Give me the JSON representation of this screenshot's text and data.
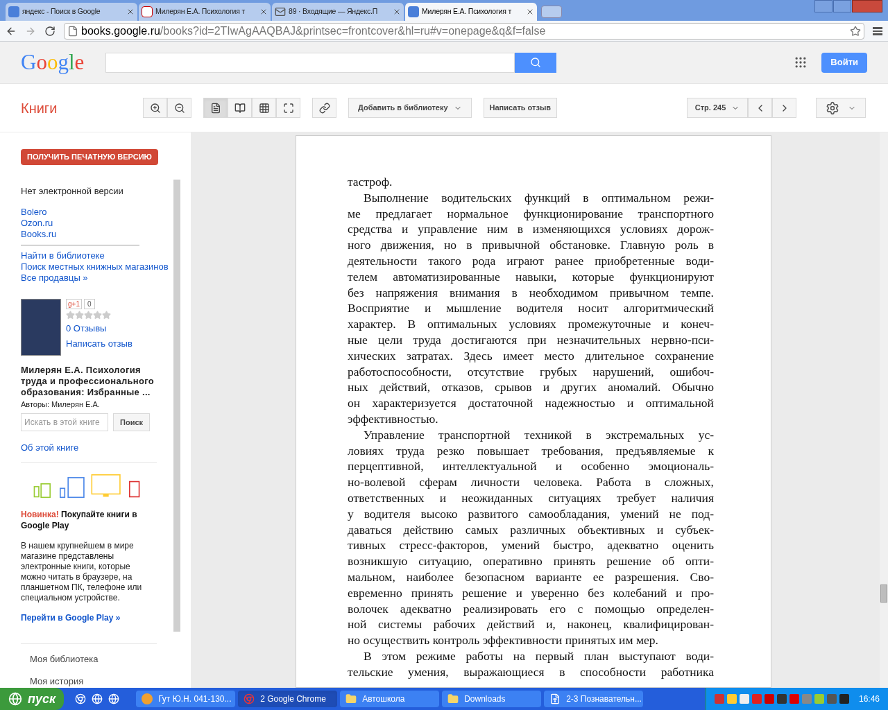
{
  "browser": {
    "tabs": [
      {
        "kind": "google",
        "title": "яндекс - Поиск в Google",
        "selected": false
      },
      {
        "kind": "yandex",
        "title": "Милерян Е.А. Психология т",
        "selected": false
      },
      {
        "kind": "mail",
        "title": "89 · Входящие — Яндекс.П",
        "selected": false
      },
      {
        "kind": "google",
        "title": "Милерян Е.А. Психология т",
        "selected": true
      }
    ],
    "url_host": "books.google.ru",
    "url_path": "/books?id=2TIwAgAAQBAJ&printsec=frontcover&hl=ru#v=onepage&q&f=false"
  },
  "header": {
    "logo": "Google",
    "signin": "Войти"
  },
  "toolbar": {
    "section": "Книги",
    "view_modes": [
      {
        "kind": "single",
        "selected": true
      },
      {
        "kind": "double",
        "selected": false
      },
      {
        "kind": "thumbnails",
        "selected": false
      },
      {
        "kind": "fullscreen",
        "selected": false
      }
    ],
    "add_library": "Добавить в библиотеку",
    "write_review": "Написать отзыв",
    "page": "Стр. 245"
  },
  "sidebar": {
    "print_button": "ПОЛУЧИТЬ ПЕЧАТНУЮ ВЕРСИЮ",
    "no_ebook": "Нет электронной версии",
    "stores": [
      "Bolero",
      "Ozon.ru",
      "Books.ru"
    ],
    "more_links": [
      "Найти в библиотеке",
      "Поиск местных книжных магазинов",
      "Все продавцы »"
    ],
    "gplus": "g+1",
    "gplus_count": "0",
    "stars": 0,
    "reviews": "0 Отзывы",
    "write_review": "Написать отзыв",
    "title": "Милерян Е.А. Психология труда и профессионального образования: Избранные ...",
    "authors": "Авторы: Милерян Е.А.",
    "search_placeholder": "Искать в этой книге",
    "search_button": "Поиск",
    "about": "Об этой книге",
    "promo": {
      "badge": "Новинка!",
      "title": "Покупайте книги в Google Play",
      "body": "В нашем крупнейшем в мире магазине представлены электронные книги, которые можно читать в браузере, на планшетном ПК, телефоне или специальном устройстве.",
      "link": "Перейти в Google Play »"
    },
    "nav": [
      "Моя библиотека",
      "Моя история"
    ]
  },
  "page": {
    "paragraphs": [
      {
        "indent": false,
        "lines": [
          "тастроф."
        ]
      },
      {
        "indent": true,
        "lines": [
          "Выполнение водительских функций в оптимальном режи-",
          "ме предлагает нормальное функционирование транспортного",
          "средства и управление ним в изменяющихся условиях дорож-",
          "ного движения, но в привычной обстановке. Главную роль в",
          "деятельности такого рода играют ранее приобретенные води-",
          "телем автоматизированные навыки, которые функционируют",
          "без напряжения внимания в необходимом привычном темпе.",
          "Восприятие и мышление водителя носит алгоритмический",
          "характер. В оптимальных условиях промежуточные и конеч-",
          "ные цели труда достигаются при незначительных нервно-пси-",
          "хических затратах. Здесь имеет место длительное сохранение",
          "работоспособности, отсутствие грубых нарушений, ошибоч-",
          "ных действий, отказов, срывов и других аномалий. Обычно",
          "он характеризуется достаточной надежностью и оптимальной",
          "эффективностью."
        ]
      },
      {
        "indent": true,
        "lines": [
          "Управление транспортной техникой в экстремальных ус-",
          "ловиях труда резко повышает требования, предъявляемые к",
          "перцептивной, интеллектуальной и особенно эмоциональ-",
          "но-волевой сферам личности человека. Работа в сложных,",
          "ответственных и неожиданных ситуациях требует наличия",
          "у водителя высоко развитого самообладания, умений не под-",
          "даваться действию самых различных объективных и субъек-",
          "тивных стресс-факторов, умений быстро, адекватно оценить",
          "возникшую ситуацию, оперативно принять решение об опти-",
          "мальном, наиболее безопасном варианте ее разрешения. Сво-",
          "евременно принять решение и уверенно без колебаний и про-",
          "волочек адекватно реализировать его с помощью определен-",
          "ной системы рабочих действий и, наконец, квалифицирован-",
          "но осуществить контроль эффективности принятых им мер."
        ]
      },
      {
        "indent": true,
        "continues": true,
        "lines": [
          "В этом режиме работы на первый план выступают води-",
          "тельские умения, выражающиеся в способности работника"
        ]
      }
    ]
  },
  "taskbar": {
    "start": "пуск",
    "tasks": [
      {
        "kind": "app",
        "label": "Гут Ю.Н. 041-130...",
        "selected": false
      },
      {
        "kind": "chrome",
        "label": "2 Google Chrome",
        "selected": true
      },
      {
        "kind": "folder",
        "label": "Автошкола",
        "selected": false
      },
      {
        "kind": "folder",
        "label": "Downloads",
        "selected": false
      },
      {
        "kind": "document",
        "label": "2-3 Познавательн...",
        "selected": false
      }
    ],
    "clock": "16:46"
  }
}
